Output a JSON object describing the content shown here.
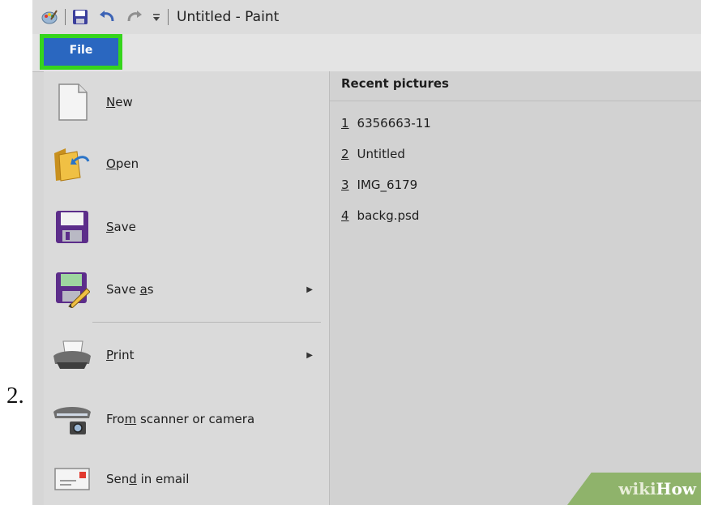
{
  "step_number": "2.",
  "window": {
    "title": "Untitled - Paint",
    "quick_access": [
      "paint-app-icon",
      "save-icon",
      "undo-icon",
      "redo-icon",
      "customize-dropdown-icon"
    ]
  },
  "file_tab": {
    "label": "File",
    "highlight_color": "#35d51c",
    "tab_color": "#2a67c0"
  },
  "menu": {
    "items": [
      {
        "label_pre": "",
        "label_key": "N",
        "label_post": "ew",
        "icon": "new-file-icon"
      },
      {
        "label_pre": "",
        "label_key": "O",
        "label_post": "pen",
        "icon": "open-folder-icon"
      },
      {
        "label_pre": "",
        "label_key": "S",
        "label_post": "ave",
        "icon": "save-disk-icon"
      },
      {
        "label_pre": "Save ",
        "label_key": "a",
        "label_post": "s",
        "icon": "save-as-icon",
        "submenu": true
      },
      {
        "label_pre": "",
        "label_key": "P",
        "label_post": "rint",
        "icon": "printer-icon",
        "submenu": true
      },
      {
        "label_pre": "Fro",
        "label_key": "m",
        "label_post": " scanner or camera",
        "icon": "scanner-icon"
      },
      {
        "label_pre": "Sen",
        "label_key": "d",
        "label_post": " in email",
        "icon": "email-icon"
      }
    ]
  },
  "recent": {
    "header": "Recent pictures",
    "items": [
      {
        "num": "1",
        "name": "6356663-11"
      },
      {
        "num": "2",
        "name": "Untitled"
      },
      {
        "num": "3",
        "name": "IMG_6179"
      },
      {
        "num": "4",
        "name": "backg.psd"
      }
    ]
  },
  "watermark": {
    "part1": "wiki",
    "part2": "How"
  },
  "colors": {
    "menu_bg": "#dadada",
    "recent_bg": "#d2d2d2",
    "accent": "#2a67c0"
  }
}
